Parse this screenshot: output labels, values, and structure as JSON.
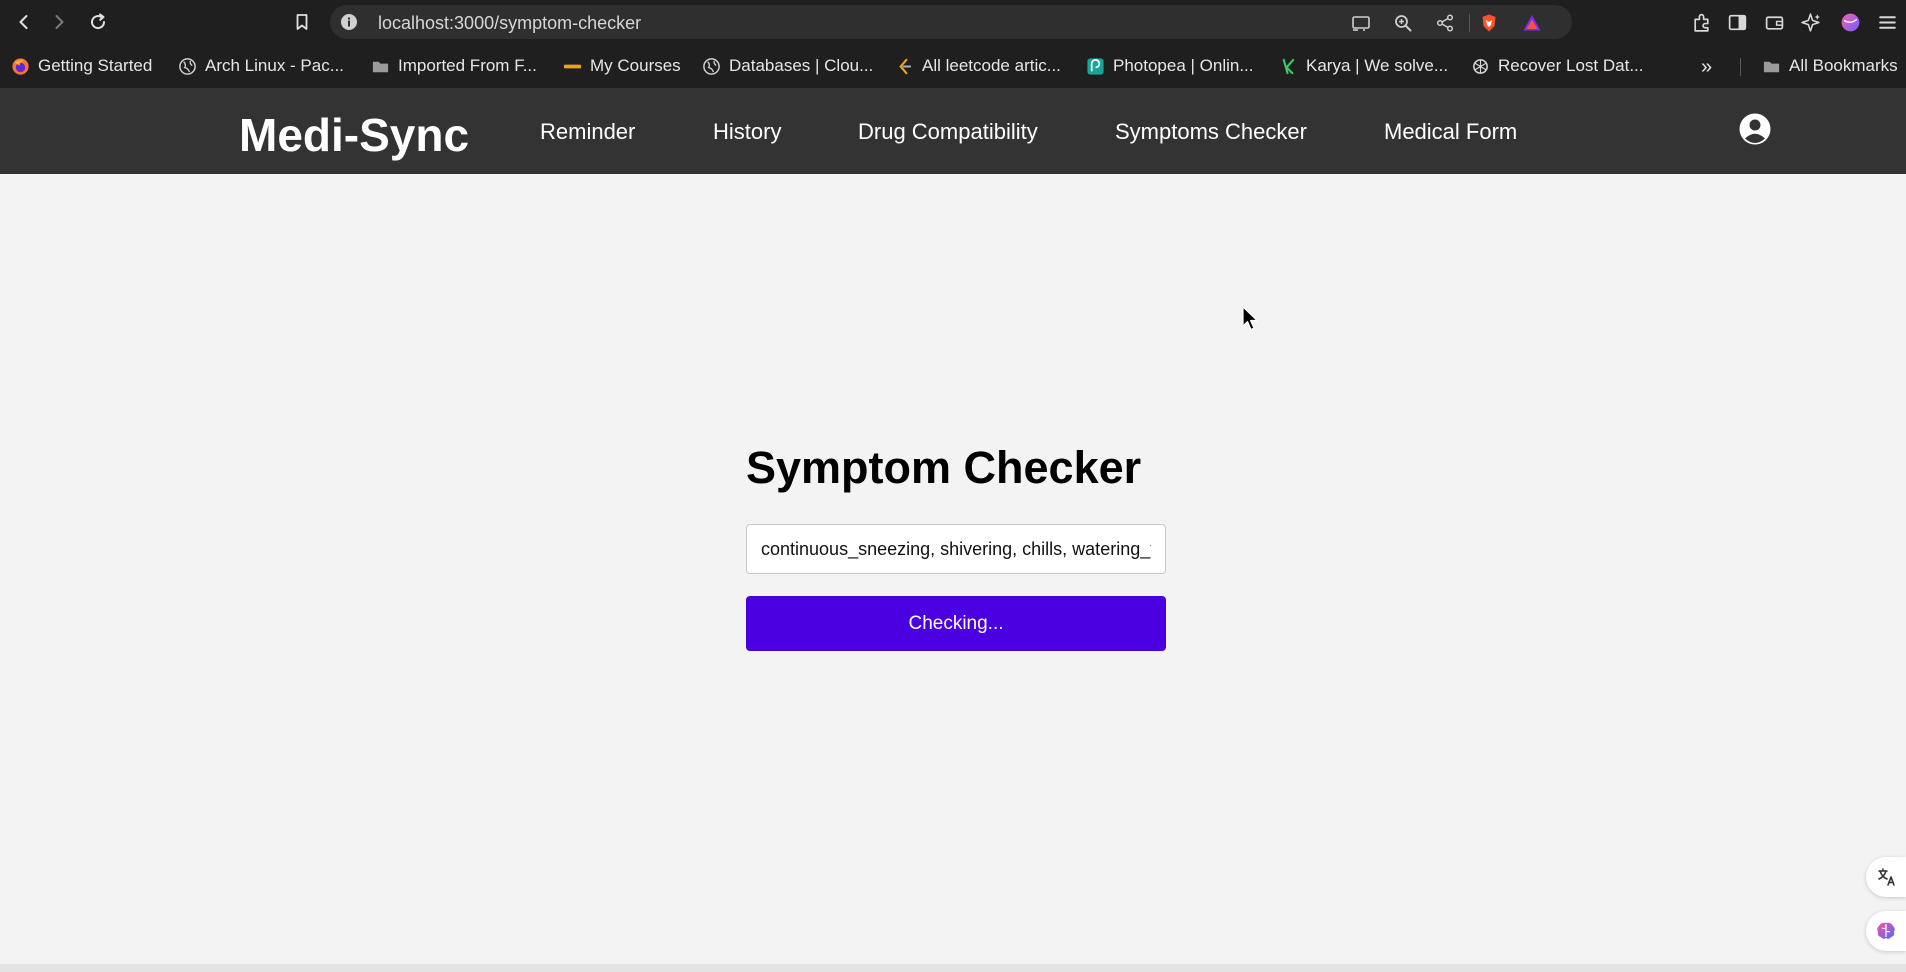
{
  "browser": {
    "url": "localhost:3000/symptom-checker",
    "bookmarks": [
      {
        "label": "Getting Started",
        "icon": "firefox-icon"
      },
      {
        "label": "Arch Linux - Pac...",
        "icon": "globe-icon"
      },
      {
        "label": "Imported From F...",
        "icon": "folder-icon"
      },
      {
        "label": "My Courses",
        "icon": "courses-icon"
      },
      {
        "label": "Databases | Clou...",
        "icon": "globe-icon"
      },
      {
        "label": "All leetcode artic...",
        "icon": "leetcode-icon"
      },
      {
        "label": "Photopea | Onlin...",
        "icon": "photopea-icon"
      },
      {
        "label": "Karya | We solve...",
        "icon": "karya-icon"
      },
      {
        "label": "Recover Lost Dat...",
        "icon": "openai-icon"
      }
    ],
    "more_bookmarks": "»",
    "all_bookmarks": "All Bookmarks"
  },
  "app": {
    "brand": "Medi-Sync",
    "nav_links": [
      "Reminder",
      "History",
      "Drug Compatibility",
      "Symptoms Checker",
      "Medical Form"
    ]
  },
  "checker": {
    "title": "Symptom Checker",
    "input_value": "continuous_sneezing, shivering, chills, watering_from_eyes",
    "button_label": "Checking..."
  },
  "colors": {
    "navbar_bg": "#333333",
    "page_bg": "#f3f3f3",
    "button_bg": "#4a00e0"
  }
}
